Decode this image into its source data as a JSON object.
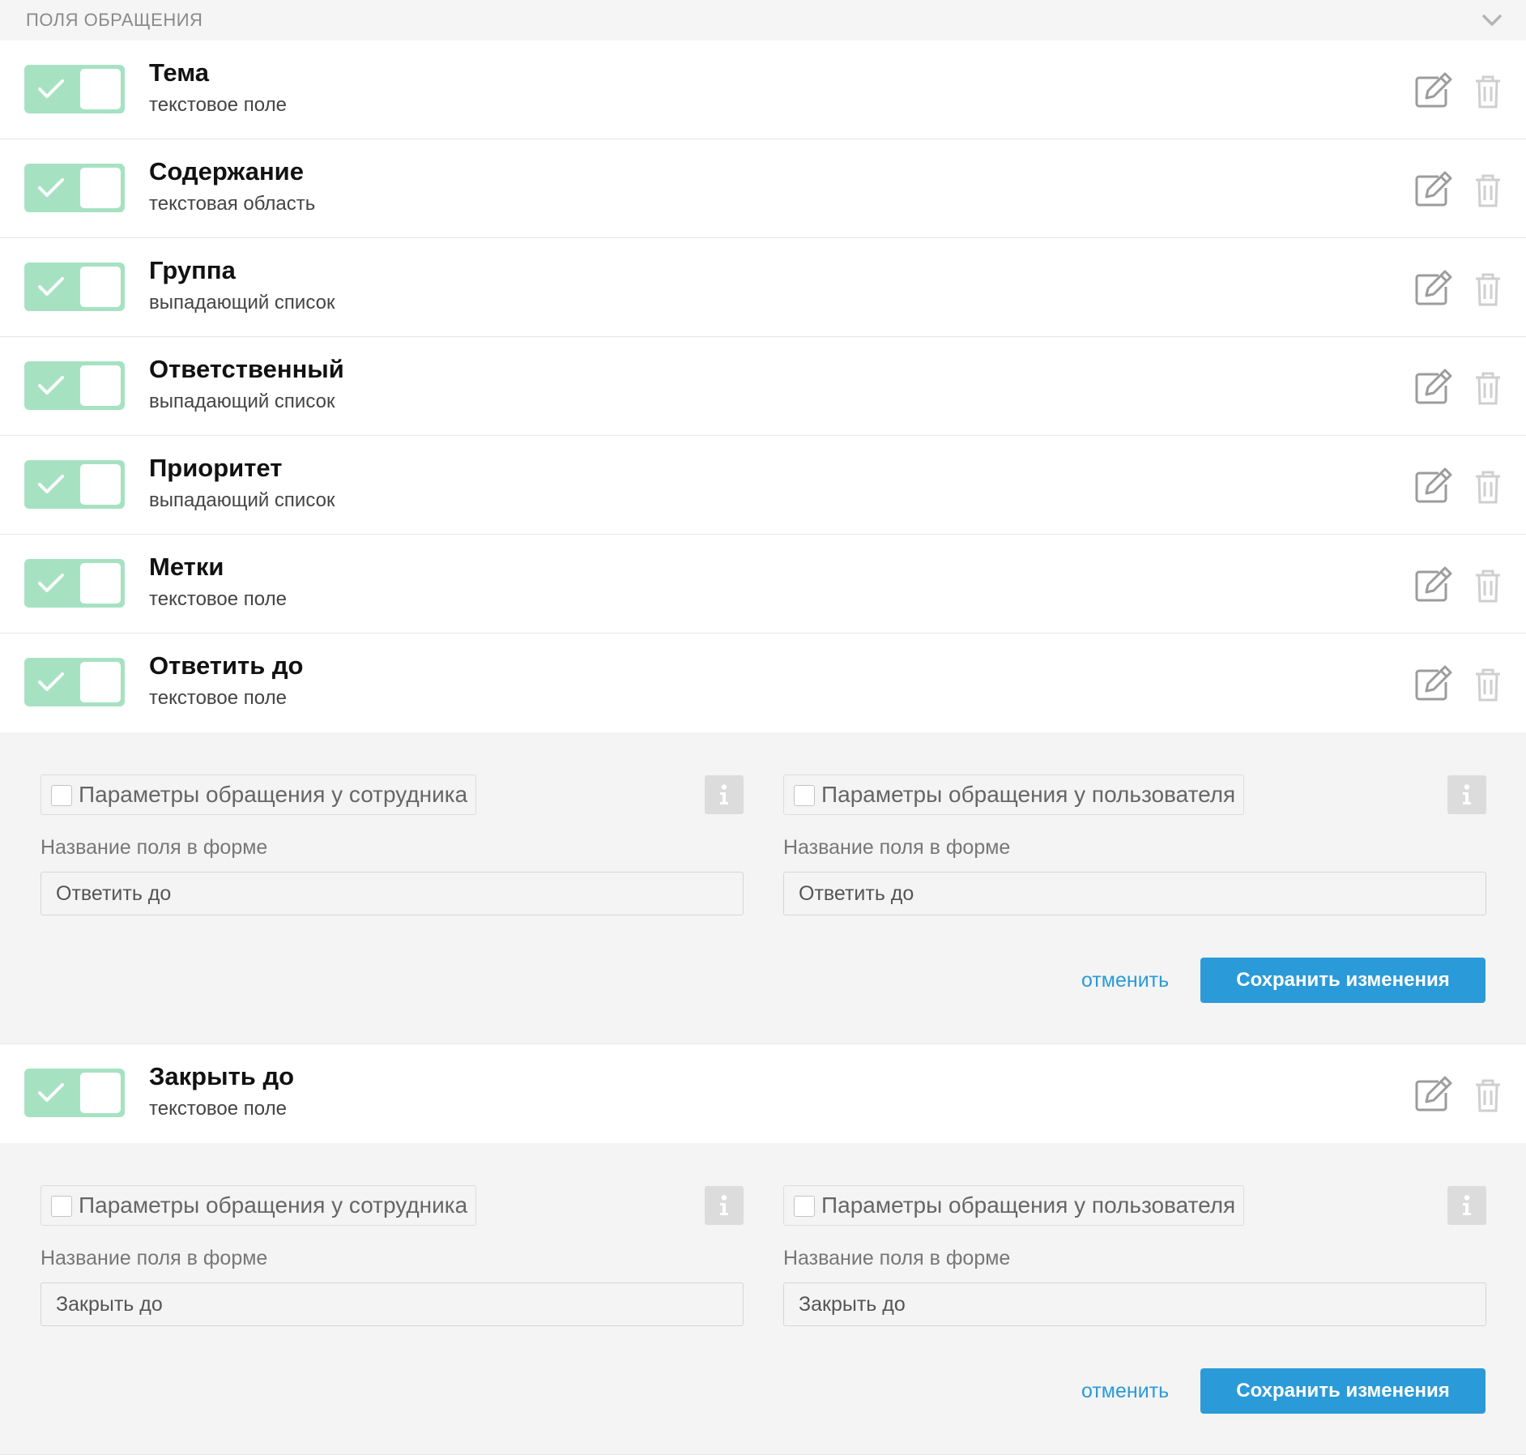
{
  "section": {
    "title": "ПОЛЯ ОБРАЩЕНИЯ",
    "collapse_icon": "chevron-down-icon"
  },
  "colors": {
    "toggle_on": "#a6e2c2",
    "accent": "#2a9bd8",
    "panel_bg": "#f4f4f4"
  },
  "fields": [
    {
      "name": "Тема",
      "type": "текстовое поле",
      "enabled": true
    },
    {
      "name": "Содержание",
      "type": "текстовая область",
      "enabled": true
    },
    {
      "name": "Группа",
      "type": "выпадающий список",
      "enabled": true
    },
    {
      "name": "Ответственный",
      "type": "выпадающий список",
      "enabled": true
    },
    {
      "name": "Приоритет",
      "type": "выпадающий список",
      "enabled": true
    },
    {
      "name": "Метки",
      "type": "текстовое поле",
      "enabled": true
    },
    {
      "name": "Ответить до",
      "type": "текстовое поле",
      "enabled": true,
      "panel": {
        "employee": {
          "checkbox_label": "Параметры обращения у сотрудника",
          "checked": false,
          "form_label": "Название поля в форме",
          "input_value": "Ответить до"
        },
        "user": {
          "checkbox_label": "Параметры обращения у пользователя",
          "checked": false,
          "form_label": "Название поля в форме",
          "input_value": "Ответить до"
        },
        "cancel_label": "отменить",
        "save_label": "Сохранить изменения"
      }
    },
    {
      "name": "Закрыть до",
      "type": "текстовое поле",
      "enabled": true,
      "panel": {
        "employee": {
          "checkbox_label": "Параметры обращения у сотрудника",
          "checked": false,
          "form_label": "Название поля в форме",
          "input_value": "Закрыть до"
        },
        "user": {
          "checkbox_label": "Параметры обращения у пользователя",
          "checked": false,
          "form_label": "Название поля в форме",
          "input_value": "Закрыть до"
        },
        "cancel_label": "отменить",
        "save_label": "Сохранить изменения"
      }
    }
  ]
}
